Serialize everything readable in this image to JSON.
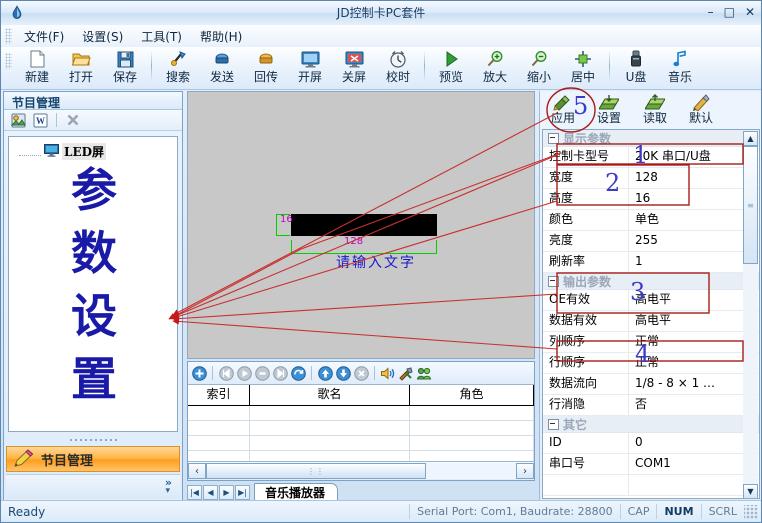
{
  "window": {
    "title": "JD控制卡PC套件",
    "minimize": "–",
    "maximize": "□",
    "close": "✕"
  },
  "menu": {
    "items": [
      {
        "label": "文件(F)",
        "name": "menu-file"
      },
      {
        "label": "设置(S)",
        "name": "menu-settings"
      },
      {
        "label": "工具(T)",
        "name": "menu-tools"
      },
      {
        "label": "帮助(H)",
        "name": "menu-help"
      }
    ]
  },
  "toolbar": {
    "buttons": [
      {
        "label": "新建",
        "icon": "new-file-icon"
      },
      {
        "label": "打开",
        "icon": "open-folder-icon"
      },
      {
        "label": "保存",
        "icon": "save-disk-icon"
      },
      {
        "label": "搜索",
        "icon": "search-icon"
      },
      {
        "label": "发送",
        "icon": "send-icon"
      },
      {
        "label": "回传",
        "icon": "receive-icon"
      },
      {
        "label": "开屏",
        "icon": "screen-on-icon"
      },
      {
        "label": "关屏",
        "icon": "screen-off-icon"
      },
      {
        "label": "校时",
        "icon": "clock-sync-icon"
      },
      {
        "label": "预览",
        "icon": "play-preview-icon"
      },
      {
        "label": "放大",
        "icon": "zoom-in-icon"
      },
      {
        "label": "缩小",
        "icon": "zoom-out-icon"
      },
      {
        "label": "居中",
        "icon": "align-center-icon"
      },
      {
        "label": "U盘",
        "icon": "usb-drive-icon"
      },
      {
        "label": "音乐",
        "icon": "music-note-icon"
      }
    ]
  },
  "left_panel": {
    "header": "节目管理",
    "tool_icons": [
      "new-program-icon",
      "new-text-icon",
      "delete-icon"
    ],
    "tree": {
      "root_label": "LED屏",
      "root_icon": "monitor-icon"
    },
    "overlay_text": [
      "参",
      "数",
      "设",
      "置"
    ],
    "bottom_button": {
      "label": "节目管理",
      "icon": "pencil-icon"
    },
    "expand_chevron": "»",
    "expand_caret": "▾"
  },
  "canvas": {
    "height_label": "16",
    "width_label": "128",
    "hint_text": "请输入文字"
  },
  "music_panel": {
    "toolbar_icons": [
      "add-icon",
      "prev-track-icon",
      "play-icon",
      "stop-icon",
      "next-track-icon",
      "refresh-icon",
      "move-up-icon",
      "move-down-icon",
      "remove-icon",
      "volume-icon",
      "tools-icon",
      "group-icon"
    ],
    "columns": [
      "索引",
      "歌名",
      "角色"
    ],
    "rows": [],
    "empty_row_count": 4,
    "hscroll": {
      "left": "‹",
      "right": "›",
      "thumb": "⋮⋮"
    }
  },
  "tabstrip": {
    "nav": [
      "|◀",
      "◀",
      "▶",
      "▶|"
    ],
    "tabs": [
      {
        "label": "音乐播放器",
        "active": true
      }
    ]
  },
  "right_panel": {
    "toolbar": [
      {
        "label": "应用",
        "icon": "apply-brush-icon"
      },
      {
        "label": "设置",
        "icon": "settings-write-icon"
      },
      {
        "label": "读取",
        "icon": "read-icon"
      },
      {
        "label": "默认",
        "icon": "default-brush-icon"
      }
    ],
    "groups": [
      {
        "name": "显示参数",
        "rows": [
          {
            "name": "控制卡型号",
            "value": "20K 串口/U盘"
          },
          {
            "name": "宽度",
            "value": "128"
          },
          {
            "name": "高度",
            "value": "16"
          },
          {
            "name": "颜色",
            "value": "单色"
          },
          {
            "name": "亮度",
            "value": "255"
          },
          {
            "name": "刷新率",
            "value": "1"
          }
        ]
      },
      {
        "name": "输出参数",
        "rows": [
          {
            "name": "OE有效",
            "value": "高电平"
          },
          {
            "name": "数据有效",
            "value": "高电平"
          },
          {
            "name": "列顺序",
            "value": "正常"
          },
          {
            "name": "行顺序",
            "value": "正常"
          },
          {
            "name": "数据流向",
            "value": "1/8 - 8 × 1  …"
          },
          {
            "name": "行消隐",
            "value": "否"
          }
        ]
      },
      {
        "name": "其它",
        "rows": [
          {
            "name": "ID",
            "value": "0"
          },
          {
            "name": "串口号",
            "value": "COM1"
          }
        ]
      }
    ],
    "scroll": {
      "up": "▲",
      "down": "▼",
      "thumb": "≡"
    }
  },
  "statusbar": {
    "ready": "Ready",
    "serial": "Serial Port: Com1, Baudrate: 28800",
    "cap": "CAP",
    "num": "NUM",
    "scrl": "SCRL"
  },
  "annotations": {
    "numbers": [
      "1",
      "2",
      "3",
      "4",
      "5"
    ],
    "accent_color": "#b01818",
    "number_color": "#3b3bc8"
  }
}
